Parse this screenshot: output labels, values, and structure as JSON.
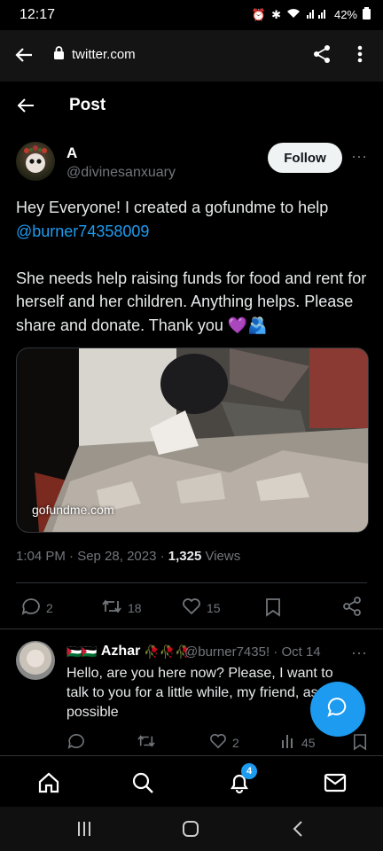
{
  "status_bar": {
    "time": "12:17",
    "battery": "42%"
  },
  "browser": {
    "url": "twitter.com"
  },
  "header": {
    "title": "Post"
  },
  "tweet": {
    "author_name": "A",
    "author_handle": "@divinesanxuary",
    "follow_label": "Follow",
    "more_label": "···",
    "text_line1": "Hey Everyone! I created a gofundme to help",
    "mention": "@burner74358009",
    "text_para2": "She needs help raising funds for food and rent for herself and her children. Anything helps. Please share and donate. Thank you 💜🫂",
    "media_label": "gofundme.com",
    "timestamp": "1:04 PM · Sep 28, 2023 · ",
    "views_count": "1,325",
    "views_label": " Views",
    "replies": "2",
    "retweets": "18",
    "likes": "15"
  },
  "reply": {
    "name": "Azhar",
    "flags": "🇵🇸🇵🇸",
    "roses": "🥀🥀🥀",
    "handle": "@burner7435! · Oct 14",
    "more_label": "···",
    "text": "Hello, are you here now? Please, I want to talk to you for a little while, my friend, as so possible",
    "likes": "2",
    "views": "45"
  },
  "nav": {
    "notifications_badge": "4"
  }
}
